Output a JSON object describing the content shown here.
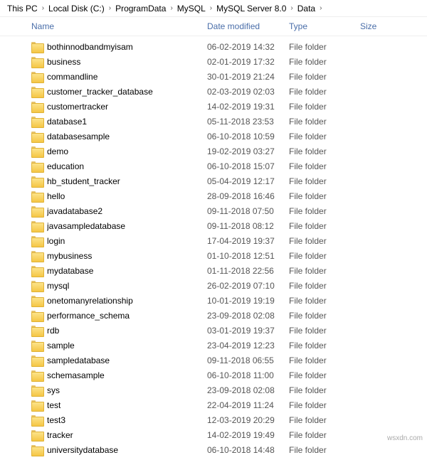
{
  "breadcrumb": [
    "This PC",
    "Local Disk (C:)",
    "ProgramData",
    "MySQL",
    "MySQL Server 8.0",
    "Data"
  ],
  "columns": {
    "name": "Name",
    "date": "Date modified",
    "type": "Type",
    "size": "Size"
  },
  "rows": [
    {
      "name": "bothinnodbandmyisam",
      "date": "06-02-2019 14:32",
      "type": "File folder",
      "size": ""
    },
    {
      "name": "business",
      "date": "02-01-2019 17:32",
      "type": "File folder",
      "size": ""
    },
    {
      "name": "commandline",
      "date": "30-01-2019 21:24",
      "type": "File folder",
      "size": ""
    },
    {
      "name": "customer_tracker_database",
      "date": "02-03-2019 02:03",
      "type": "File folder",
      "size": ""
    },
    {
      "name": "customertracker",
      "date": "14-02-2019 19:31",
      "type": "File folder",
      "size": ""
    },
    {
      "name": "database1",
      "date": "05-11-2018 23:53",
      "type": "File folder",
      "size": ""
    },
    {
      "name": "databasesample",
      "date": "06-10-2018 10:59",
      "type": "File folder",
      "size": ""
    },
    {
      "name": "demo",
      "date": "19-02-2019 03:27",
      "type": "File folder",
      "size": ""
    },
    {
      "name": "education",
      "date": "06-10-2018 15:07",
      "type": "File folder",
      "size": ""
    },
    {
      "name": "hb_student_tracker",
      "date": "05-04-2019 12:17",
      "type": "File folder",
      "size": ""
    },
    {
      "name": "hello",
      "date": "28-09-2018 16:46",
      "type": "File folder",
      "size": ""
    },
    {
      "name": "javadatabase2",
      "date": "09-11-2018 07:50",
      "type": "File folder",
      "size": ""
    },
    {
      "name": "javasampledatabase",
      "date": "09-11-2018 08:12",
      "type": "File folder",
      "size": ""
    },
    {
      "name": "login",
      "date": "17-04-2019 19:37",
      "type": "File folder",
      "size": ""
    },
    {
      "name": "mybusiness",
      "date": "01-10-2018 12:51",
      "type": "File folder",
      "size": ""
    },
    {
      "name": "mydatabase",
      "date": "01-11-2018 22:56",
      "type": "File folder",
      "size": ""
    },
    {
      "name": "mysql",
      "date": "26-02-2019 07:10",
      "type": "File folder",
      "size": ""
    },
    {
      "name": "onetomanyrelationship",
      "date": "10-01-2019 19:19",
      "type": "File folder",
      "size": ""
    },
    {
      "name": "performance_schema",
      "date": "23-09-2018 02:08",
      "type": "File folder",
      "size": ""
    },
    {
      "name": "rdb",
      "date": "03-01-2019 19:37",
      "type": "File folder",
      "size": ""
    },
    {
      "name": "sample",
      "date": "23-04-2019 12:23",
      "type": "File folder",
      "size": ""
    },
    {
      "name": "sampledatabase",
      "date": "09-11-2018 06:55",
      "type": "File folder",
      "size": ""
    },
    {
      "name": "schemasample",
      "date": "06-10-2018 11:00",
      "type": "File folder",
      "size": ""
    },
    {
      "name": "sys",
      "date": "23-09-2018 02:08",
      "type": "File folder",
      "size": ""
    },
    {
      "name": "test",
      "date": "22-04-2019 11:24",
      "type": "File folder",
      "size": ""
    },
    {
      "name": "test3",
      "date": "12-03-2019 20:29",
      "type": "File folder",
      "size": ""
    },
    {
      "name": "tracker",
      "date": "14-02-2019 19:49",
      "type": "File folder",
      "size": ""
    },
    {
      "name": "universitydatabase",
      "date": "06-10-2018 14:48",
      "type": "File folder",
      "size": ""
    }
  ],
  "watermark": "wsxdn.com"
}
